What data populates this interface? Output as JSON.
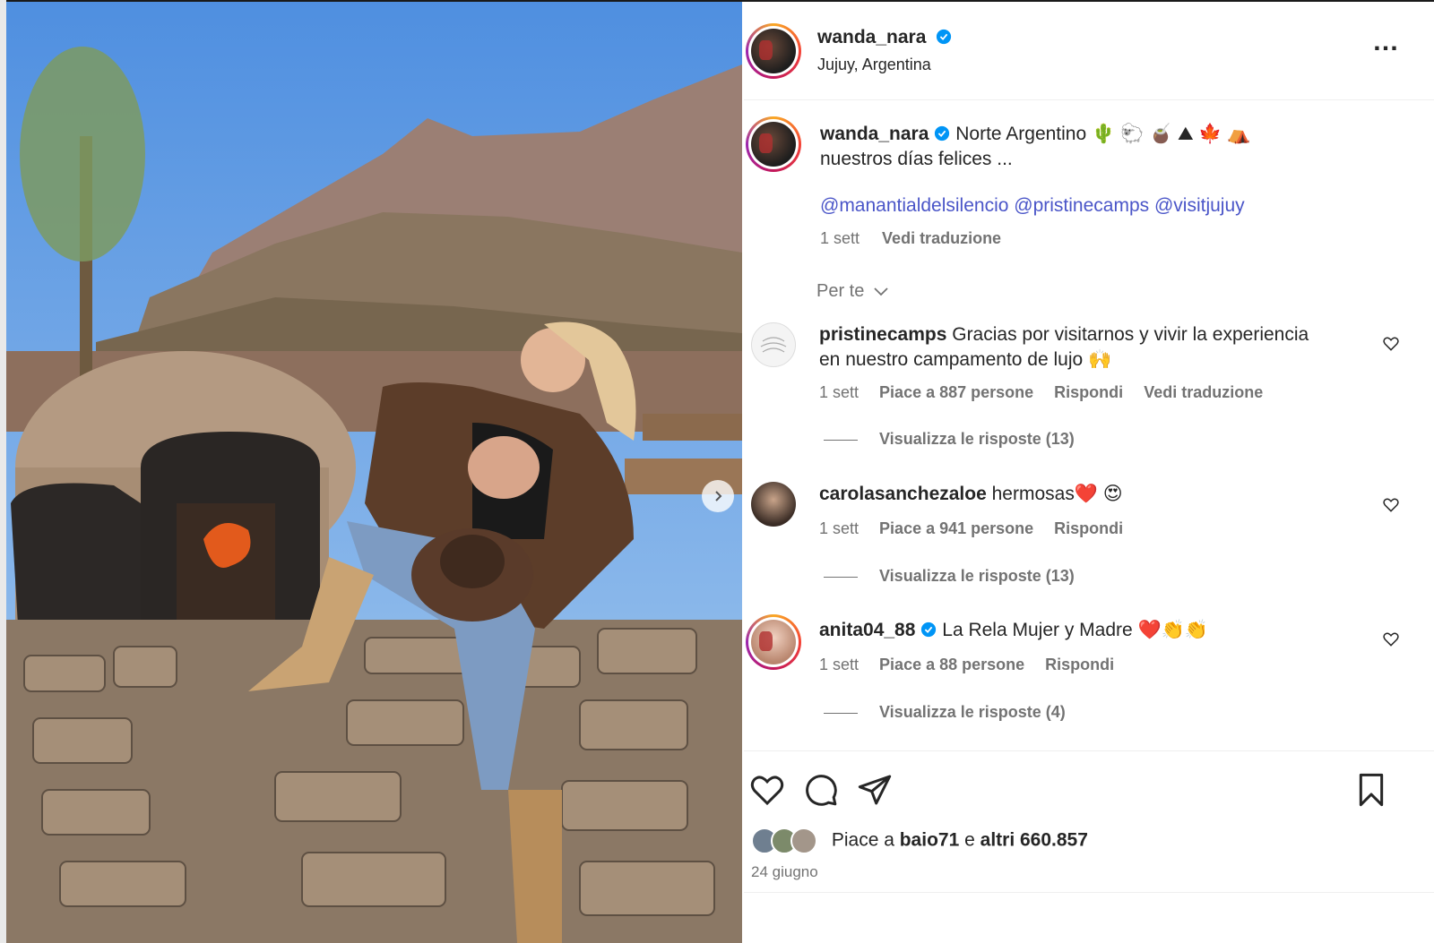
{
  "post": {
    "username": "wanda_nara",
    "location": "Jujuy, Argentina",
    "caption_line1": "Norte Argentino 🌵 🐑 🧉 ⛰ 🍁 ⛺",
    "caption_line2": "nuestros días felices ...",
    "mentions": "@manantialdelsilencio @pristinecamps @visitjujuy",
    "time": "1 sett",
    "translate": "Vedi traduzione",
    "sort_label": "Per te"
  },
  "comments": [
    {
      "username": "pristinecamps",
      "text_line1": "Gracias por visitarnos y vivir la experiencia",
      "text_line2": "en nuestro campamento de lujo 🙌",
      "time": "1 sett",
      "likes": "Piace a 887 persone",
      "reply": "Rispondi",
      "translate": "Vedi traduzione",
      "replies": "Visualizza le risposte (13)"
    },
    {
      "username": "carolasanchezaloe",
      "text_line1": "hermosas❤️ 😍",
      "time": "1 sett",
      "likes": "Piace a 941 persone",
      "reply": "Rispondi",
      "replies": "Visualizza le risposte (13)"
    },
    {
      "username": "anita04_88",
      "text_line1": "La Rela Mujer y Madre ❤️👏👏",
      "time": "1 sett",
      "likes": "Piace a 88 persone",
      "reply": "Rispondi",
      "replies": "Visualizza le risposte (4)"
    }
  ],
  "likes": {
    "prefix": "Piace a",
    "user": "baio71",
    "middle": "e",
    "others": "altri 660.857"
  },
  "date": "24 giugno",
  "colors": {
    "accent_link": "#4a55c8",
    "verified": "#0095f6",
    "secondary_text": "#737373"
  },
  "icons": [
    "more-icon",
    "verified-icon",
    "heart-icon",
    "comment-icon",
    "share-icon",
    "bookmark-icon",
    "chevron-down-icon",
    "next-arrow-icon"
  ]
}
